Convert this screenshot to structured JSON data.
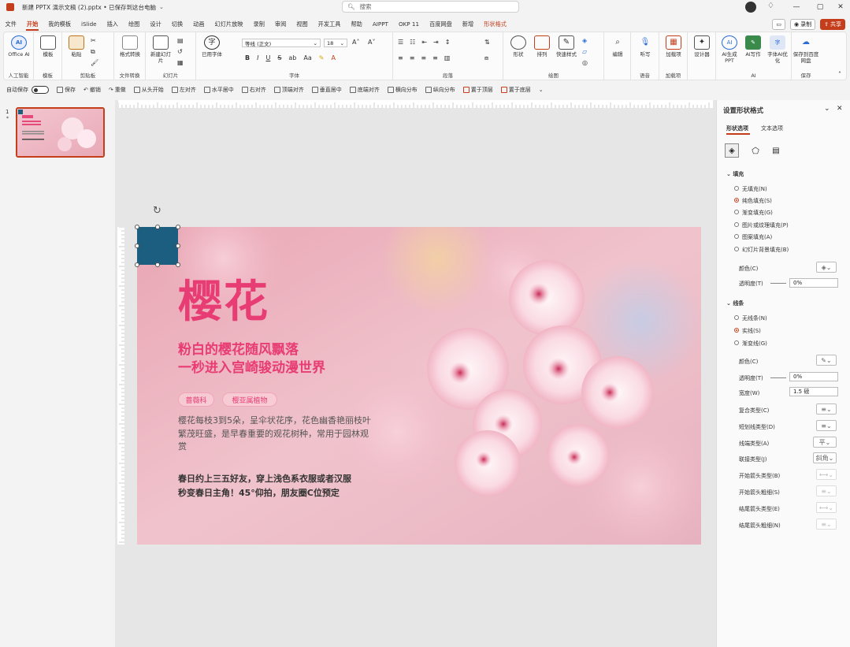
{
  "titlebar": {
    "title": "新建 PPTX 演示文稿 (2).pptx • 已保存到这台电脑",
    "search_placeholder": "搜索"
  },
  "tabs": [
    "文件",
    "开始",
    "我的模板",
    "iSlide",
    "插入",
    "绘图",
    "设计",
    "切换",
    "动画",
    "幻灯片放映",
    "录制",
    "审阅",
    "视图",
    "开发工具",
    "帮助",
    "AIPPT",
    "OKP 11",
    "百度网盘",
    "新增",
    "形状格式"
  ],
  "active_tab": "开始",
  "right_buttons": {
    "record": "录制",
    "share": "共享"
  },
  "ribbon": {
    "groups": [
      {
        "label": "人工智能",
        "btn": "Office AI"
      },
      {
        "label": "模板",
        "btn": "模板"
      },
      {
        "label": "剪贴板",
        "btn": "粘贴"
      },
      {
        "label": "文件转换",
        "btn": "格式转换"
      },
      {
        "label": "幻灯片",
        "btn": "新建幻灯片"
      },
      {
        "label": "字体",
        "btn": "已用字体"
      },
      {
        "label": "段落"
      },
      {
        "label": "绘图",
        "btns": [
          "形状",
          "排列",
          "快速样式"
        ]
      },
      {
        "label": "",
        "btn": "编辑"
      },
      {
        "label": "语音",
        "btn": "听写"
      },
      {
        "label": "加载项",
        "btn": "加载项"
      },
      {
        "label": "",
        "btn": "设计器"
      },
      {
        "label": "AI",
        "btns": [
          "AI生成PPT",
          "AI写作",
          "字体AI优化"
        ]
      },
      {
        "label": "保存",
        "btn": "保存到百度网盘"
      }
    ],
    "font_name": "等线 (正文)",
    "font_size": "18"
  },
  "qat": {
    "autosave": "自动保存",
    "items": [
      "保存",
      "撤销",
      "重做",
      "从头开始",
      "左对齐",
      "水平居中",
      "右对齐",
      "顶端对齐",
      "垂直居中",
      "底端对齐",
      "横向分布",
      "纵向分布",
      "置于顶层",
      "置于底层"
    ]
  },
  "slide_number": "1",
  "slide": {
    "title": "樱花",
    "subtitle1": "粉白的樱花随风飘落",
    "subtitle2": "一秒进入宫崎骏动漫世界",
    "tag1": "蔷薇科",
    "tag2": "樱亚属植物",
    "body": "樱花每枝3到5朵，呈伞状花序，花色幽香艳丽枝叶繁茂旺盛，是早春重要的观花树种，常用于园林观赏",
    "footer1": "春日约上三五好友，穿上浅色系衣服或者汉服",
    "footer2": "秒变春日主角！45°仰拍，朋友圈C位预定"
  },
  "selected_shape_color": "#1b5e80",
  "pane": {
    "title": "设置形状格式",
    "tab1": "形状选项",
    "tab2": "文本选项",
    "fill_section": "填充",
    "fill_options": [
      "无填充(N)",
      "纯色填充(S)",
      "渐变填充(G)",
      "图片或纹理填充(P)",
      "图案填充(A)",
      "幻灯片背景填充(B)"
    ],
    "fill_selected": 1,
    "fill_color_label": "颜色(C)",
    "fill_transparency_label": "透明度(T)",
    "fill_transparency": "0%",
    "line_section": "线条",
    "line_options": [
      "无线条(N)",
      "实线(S)",
      "渐变线(G)"
    ],
    "line_selected": 1,
    "line_props": [
      "颜色(C)",
      "透明度(T)",
      "宽度(W)",
      "复合类型(C)",
      "短划线类型(D)",
      "线端类型(A)",
      "联接类型(J)",
      "开始箭头类型(B)",
      "开始箭头粗细(S)",
      "结尾箭头类型(E)",
      "结尾箭头粗细(N)"
    ],
    "line_transparency": "0%",
    "line_width": "1.5 磅",
    "cap_type": "平",
    "join_type": "斜角"
  }
}
